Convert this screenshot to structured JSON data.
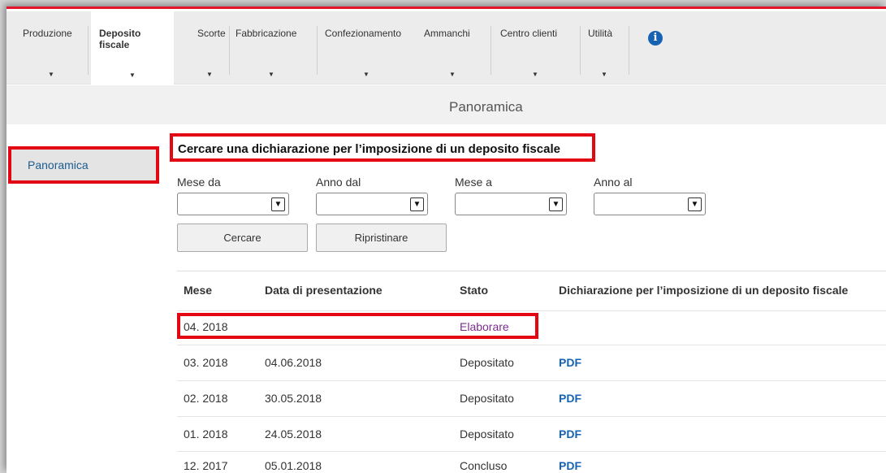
{
  "nav": {
    "items": [
      {
        "label": "Produzione"
      },
      {
        "label": "Deposito\nfiscale"
      },
      {
        "label": "Scorte"
      },
      {
        "label": "Fabbricazione"
      },
      {
        "label": "Confezionamento"
      },
      {
        "label": "Ammanchi"
      },
      {
        "label": "Centro clienti"
      },
      {
        "label": "Utilità"
      }
    ],
    "caret": "▼",
    "info_icon": "i"
  },
  "page_title": "Panoramica",
  "sidebar": {
    "item": "Panoramica"
  },
  "form": {
    "title": "Cercare una dichiarazione per l’imposizione di un deposito fiscale",
    "labels": {
      "month_from": "Mese da",
      "year_from": "Anno dal",
      "month_to": "Mese a",
      "year_to": "Anno al"
    },
    "select_arrow": "▼",
    "search_button": "Cercare",
    "reset_button": "Ripristinare"
  },
  "table": {
    "headers": {
      "month": "Mese",
      "submitted": "Data di presentazione",
      "status": "Stato",
      "declaration": "Dichiarazione per l’imposizione di un deposito fiscale"
    },
    "rows": [
      {
        "month": "04. 2018",
        "date": "",
        "status": "Elaborare",
        "doc": ""
      },
      {
        "month": "03. 2018",
        "date": "04.06.2018",
        "status": "Depositato",
        "doc": "PDF"
      },
      {
        "month": "02. 2018",
        "date": "30.05.2018",
        "status": "Depositato",
        "doc": "PDF"
      },
      {
        "month": "01. 2018",
        "date": "24.05.2018",
        "status": "Depositato",
        "doc": "PDF"
      },
      {
        "month": "12. 2017",
        "date": "05.01.2018",
        "status": "Concluso",
        "doc": "PDF"
      }
    ]
  },
  "colors": {
    "accent_red": "#e30613",
    "link_blue": "#1663b3",
    "action_purple": "#7b2f8e"
  }
}
